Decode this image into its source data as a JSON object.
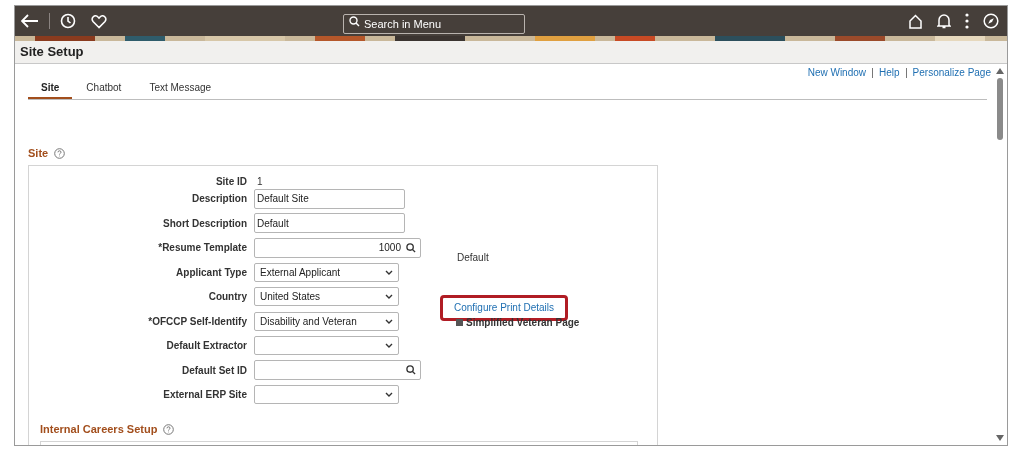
{
  "header": {
    "search": {
      "placeholder": "Search in Menu"
    }
  },
  "page_title": "Site Setup",
  "links": [
    "New Window",
    "Help",
    "Personalize Page"
  ],
  "tabs": [
    {
      "label": "Site",
      "selected": true
    },
    {
      "label": "Chatbot",
      "selected": false
    },
    {
      "label": "Text Message",
      "selected": false
    }
  ],
  "section": {
    "title": "Site",
    "fields": [
      {
        "kind": "display",
        "label": "Site ID",
        "value": "1"
      },
      {
        "kind": "text",
        "label": "Description",
        "value": "Default Site"
      },
      {
        "kind": "text",
        "label": "Short Description",
        "value": "Default"
      },
      {
        "kind": "lookup",
        "label": "*Resume Template",
        "value": "1000",
        "aside": {
          "kind": "text",
          "text": "Default"
        }
      },
      {
        "kind": "select",
        "label": "Applicant Type",
        "value": "External Applicant"
      },
      {
        "kind": "select",
        "label": "Country",
        "value": "United States",
        "aside": {
          "kind": "link",
          "text": "Configure Print Details",
          "highlight": true
        }
      },
      {
        "kind": "select",
        "label": "*OFCCP Self-Identify",
        "value": "Disability and Veteran",
        "aside": {
          "kind": "checkbox",
          "text": "Simplified Veteran Page",
          "checked": true
        }
      },
      {
        "kind": "select",
        "label": "Default Extractor"
      },
      {
        "kind": "lookup",
        "label": "Default Set ID"
      },
      {
        "kind": "select",
        "label": "External ERP Site"
      }
    ]
  },
  "subsection": {
    "title": "Internal Careers Setup"
  }
}
